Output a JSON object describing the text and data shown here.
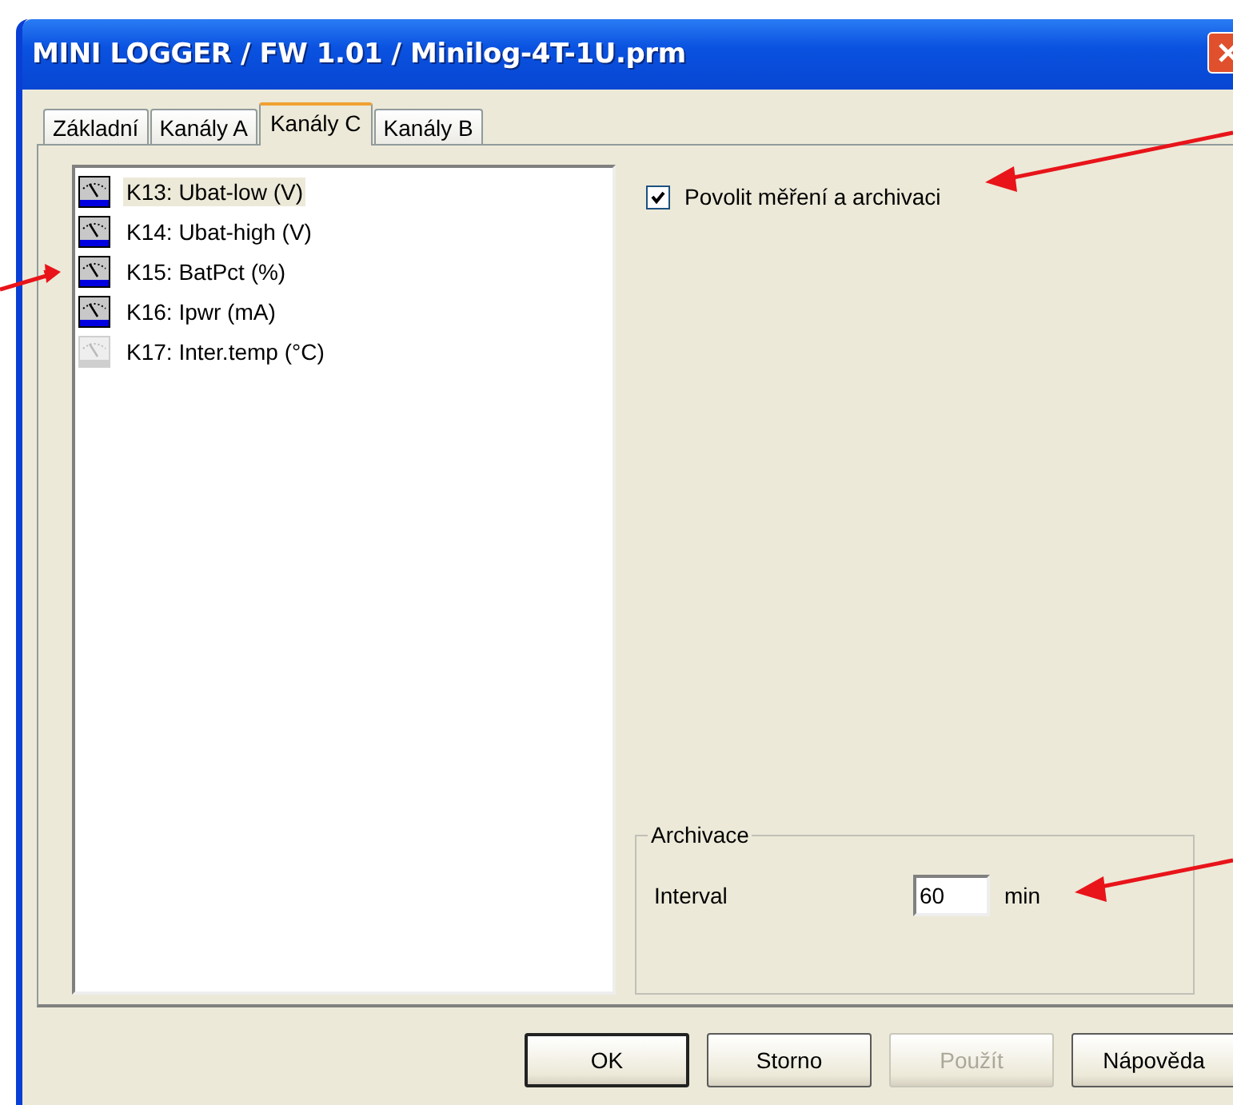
{
  "window": {
    "title": "MINI LOGGER / FW 1.01 / Minilog-4T-1U.prm"
  },
  "tabs": [
    {
      "label": "Základní",
      "selected": false
    },
    {
      "label": "Kanály A",
      "selected": false
    },
    {
      "label": "Kanály C",
      "selected": true
    },
    {
      "label": "Kanály B",
      "selected": false
    }
  ],
  "channels": [
    {
      "label": "K13: Ubat-low (V)",
      "selected": true,
      "enabled": true
    },
    {
      "label": "K14: Ubat-high (V)",
      "selected": false,
      "enabled": true
    },
    {
      "label": "K15: BatPct (%)",
      "selected": false,
      "enabled": true
    },
    {
      "label": "K16: Ipwr (mA)",
      "selected": false,
      "enabled": true
    },
    {
      "label": "K17: Inter.temp (°C)",
      "selected": false,
      "enabled": false
    }
  ],
  "enable_checkbox": {
    "label": "Povolit měření a archivaci",
    "checked": true
  },
  "archive_group": {
    "title": "Archivace",
    "interval_label": "Interval",
    "interval_value": "60",
    "unit": "min"
  },
  "buttons": [
    {
      "label": "OK",
      "default": true,
      "disabled": false
    },
    {
      "label": "Storno",
      "default": false,
      "disabled": false
    },
    {
      "label": "Použít",
      "default": false,
      "disabled": true
    },
    {
      "label": "Nápověda",
      "default": false,
      "disabled": false
    }
  ]
}
